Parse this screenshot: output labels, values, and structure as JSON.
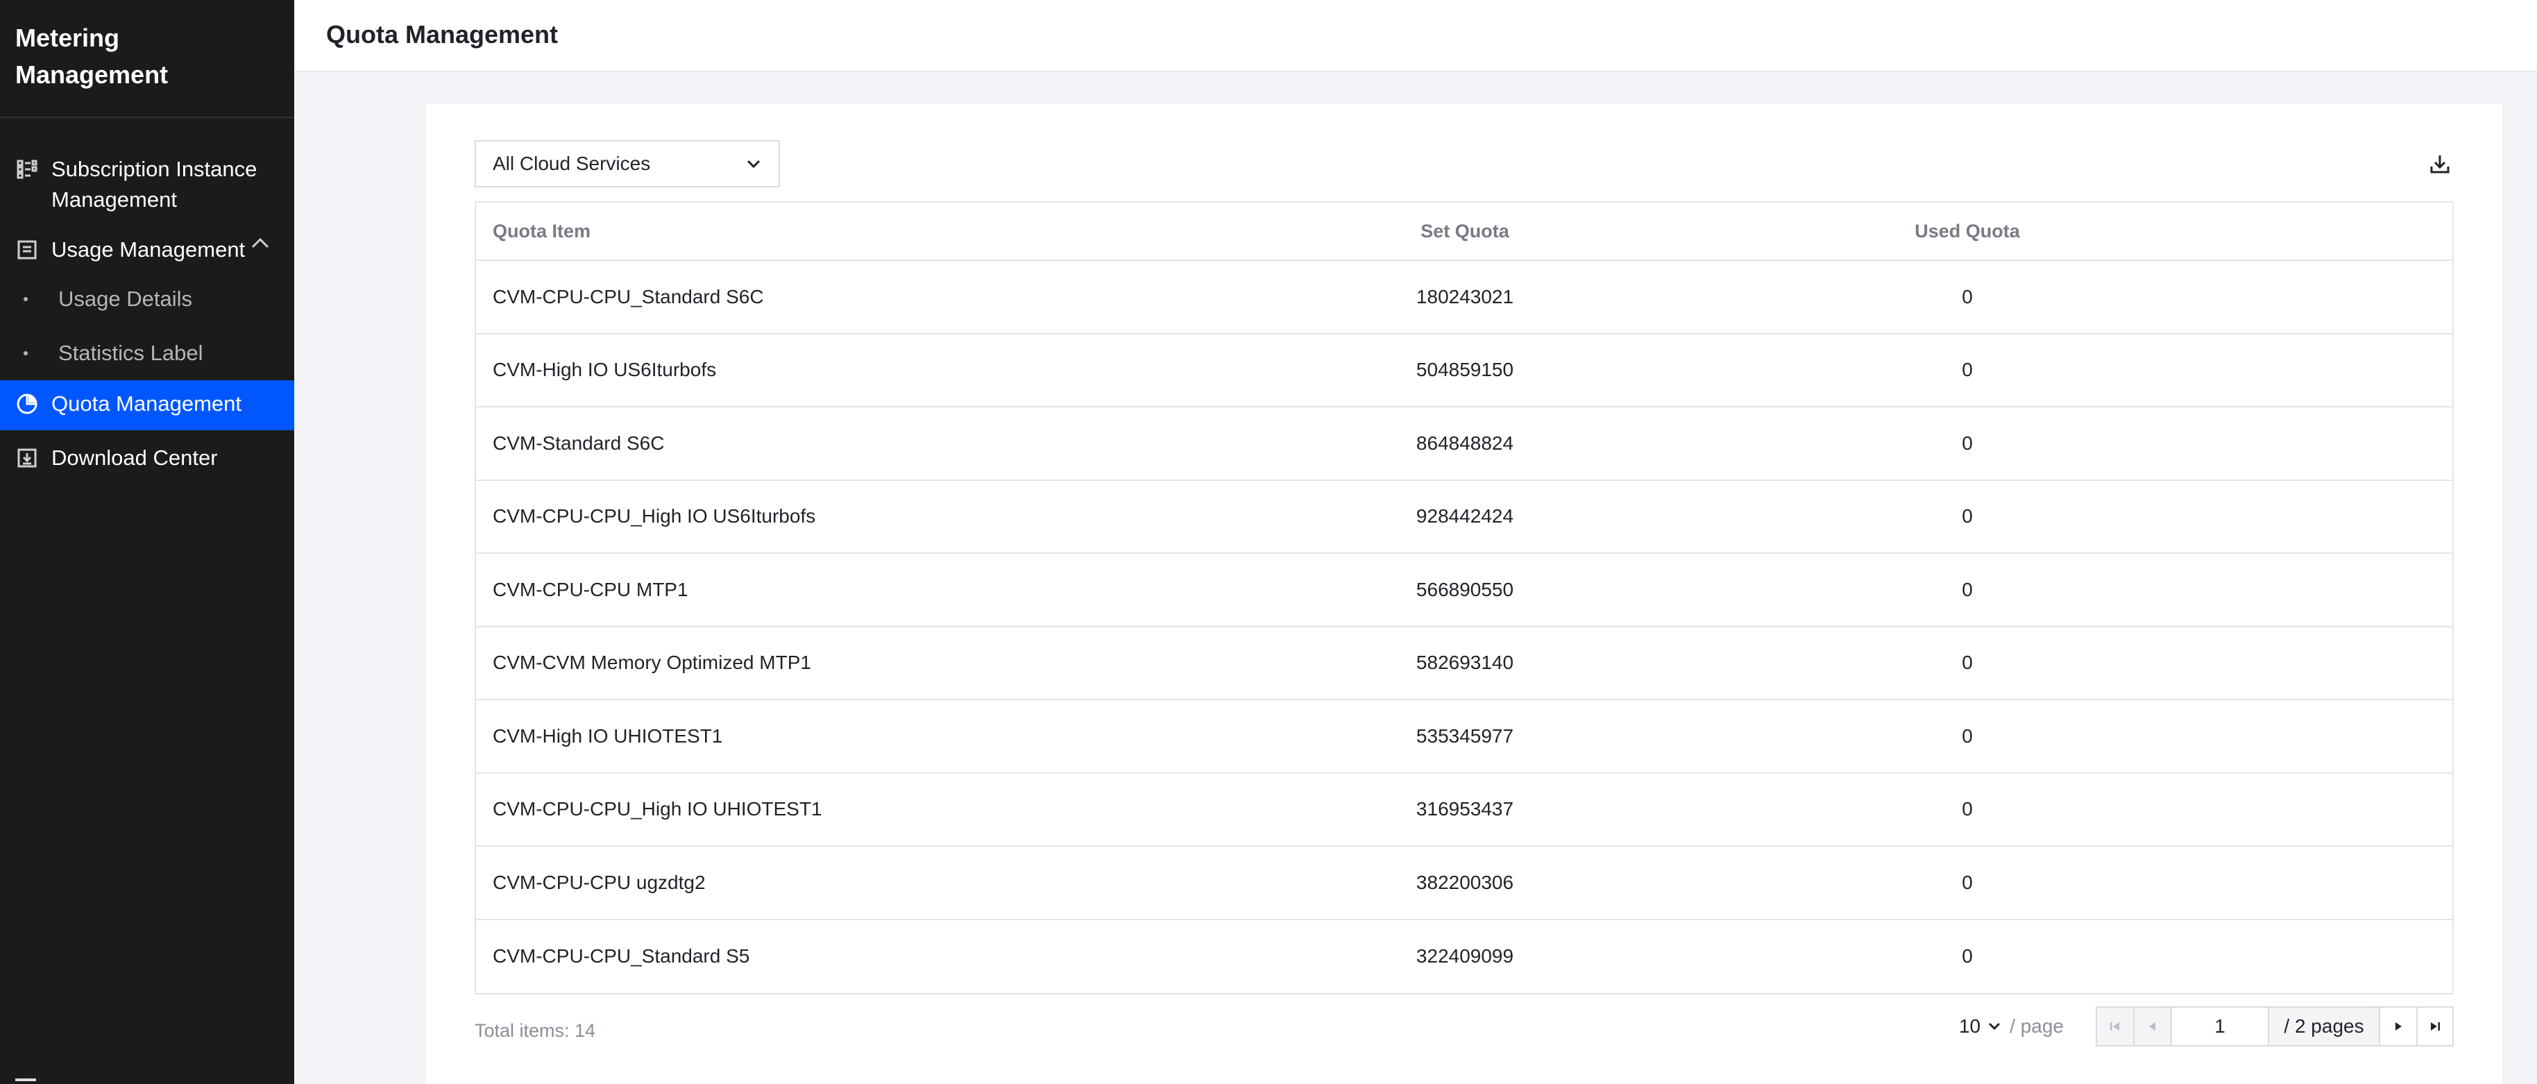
{
  "sidebar": {
    "title": "Metering Management",
    "items": [
      {
        "label": "Subscription Instance Management",
        "icon": "list-icon"
      },
      {
        "label": "Usage Management",
        "icon": "document-icon"
      },
      {
        "label": "Usage Details"
      },
      {
        "label": "Statistics Label"
      },
      {
        "label": "Quota Management",
        "icon": "pie-chart-icon"
      },
      {
        "label": "Download Center",
        "icon": "download-box-icon"
      }
    ]
  },
  "header": {
    "title": "Quota Management"
  },
  "filter": {
    "selected": "All Cloud Services"
  },
  "table": {
    "columns": [
      "Quota Item",
      "Set Quota",
      "Used Quota"
    ],
    "rows": [
      [
        "CVM-CPU-CPU_Standard S6C",
        "180243021",
        "0"
      ],
      [
        "CVM-High IO US6Iturbofs",
        "504859150",
        "0"
      ],
      [
        "CVM-Standard S6C",
        "864848824",
        "0"
      ],
      [
        "CVM-CPU-CPU_High IO US6Iturbofs",
        "928442424",
        "0"
      ],
      [
        "CVM-CPU-CPU MTP1",
        "566890550",
        "0"
      ],
      [
        "CVM-CVM Memory Optimized MTP1",
        "582693140",
        "0"
      ],
      [
        "CVM-High IO UHIOTEST1",
        "535345977",
        "0"
      ],
      [
        "CVM-CPU-CPU_High IO UHIOTEST1",
        "316953437",
        "0"
      ],
      [
        "CVM-CPU-CPU ugzdtg2",
        "382200306",
        "0"
      ],
      [
        "CVM-CPU-CPU_Standard S5",
        "322409099",
        "0"
      ]
    ]
  },
  "footer": {
    "total": "Total items: 14",
    "page_size": "10",
    "per_page": "/ page",
    "current_page": "1",
    "total_pages": "/ 2 pages"
  },
  "colors": {
    "active": "#0057ff",
    "sidebar_bg": "#1b1b1b"
  }
}
